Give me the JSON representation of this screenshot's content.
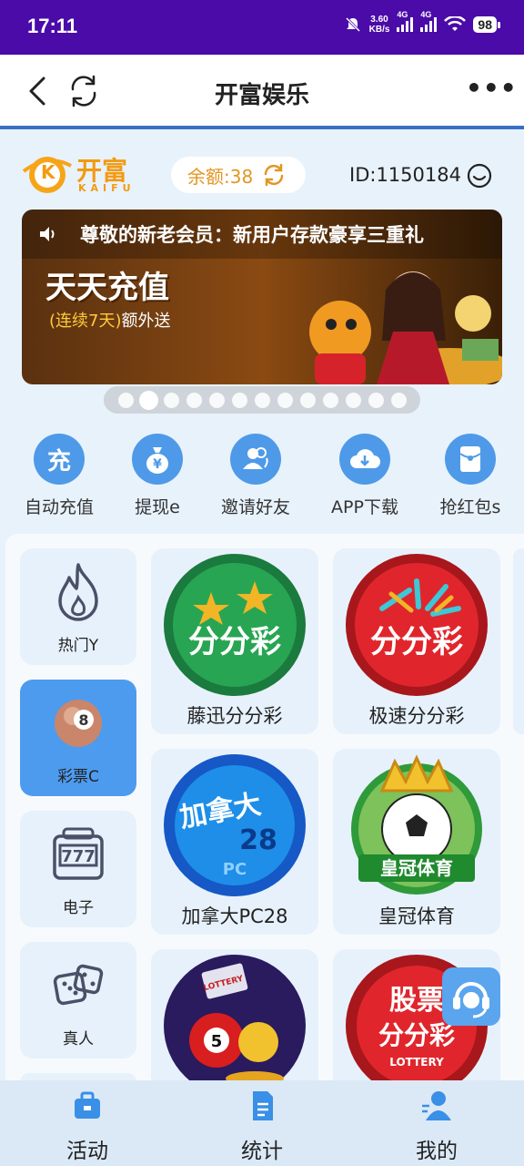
{
  "status_bar": {
    "time": "17:11",
    "net_speed": "3.60",
    "net_unit": "KB/s",
    "sig1": "4G",
    "sig2": "4G",
    "battery": "98"
  },
  "header": {
    "title": "开富娱乐"
  },
  "brand": {
    "name": "开富",
    "sub": "KAIFU",
    "logo_letter": "K"
  },
  "account": {
    "balance": "余额:38",
    "user_id": "ID:1150184"
  },
  "banner": {
    "notice": "尊敬的新老会员：新用户存款豪享三重礼",
    "headline": "天天充值",
    "sub_highlight": "(连续7天)",
    "sub_rest": "额外送",
    "slide_count": 13,
    "active_slide": 2
  },
  "quick_actions": [
    {
      "label": "自动充值",
      "icon": "recharge-icon",
      "glyph": "充"
    },
    {
      "label": "提现e",
      "icon": "money-bag-icon",
      "glyph": "¥"
    },
    {
      "label": "邀请好友",
      "icon": "invite-friends-icon",
      "glyph": ""
    },
    {
      "label": "APP下载",
      "icon": "cloud-download-icon",
      "glyph": ""
    },
    {
      "label": "抢红包s",
      "icon": "red-envelope-icon",
      "glyph": ""
    }
  ],
  "categories": [
    {
      "label": "热门Y",
      "icon": "flame-icon",
      "active": false
    },
    {
      "label": "彩票C",
      "icon": "lottery-ball-icon",
      "active": true
    },
    {
      "label": "电子",
      "icon": "slot-777-icon",
      "active": false
    },
    {
      "label": "真人",
      "icon": "dice-icon",
      "active": false
    }
  ],
  "games": [
    {
      "label": "藤迅分分彩",
      "logo_text": "分分彩",
      "icon": "tengxun-ffc-logo"
    },
    {
      "label": "极速分分彩",
      "logo_text": "分分彩",
      "icon": "jisu-ffc-logo"
    },
    {
      "label": "加拿大PC28",
      "logo_text": "加拿大",
      "logo_num": "28",
      "logo_sub": "PC",
      "icon": "canada-pc28-logo"
    },
    {
      "label": "皇冠体育",
      "logo_text": "皇冠体育",
      "icon": "crown-sports-logo"
    },
    {
      "label": "",
      "logo_text": "LOTTERY",
      "icon": "lottery-balls-logo"
    },
    {
      "label": "",
      "logo_text": "股票",
      "logo_text2": "分分彩",
      "logo_sub": "LOTTERY",
      "icon": "stock-ffc-logo"
    }
  ],
  "bottom_nav": [
    {
      "label": "活动",
      "icon": "briefcase-icon"
    },
    {
      "label": "统计",
      "icon": "document-icon"
    },
    {
      "label": "我的",
      "icon": "user-icon"
    }
  ],
  "colors": {
    "status_bar": "#4a0ba8",
    "accent": "#4e9ae8",
    "header_underline": "#3b6fc6",
    "brand_orange": "#f39a12",
    "balance_text": "#e29723"
  }
}
